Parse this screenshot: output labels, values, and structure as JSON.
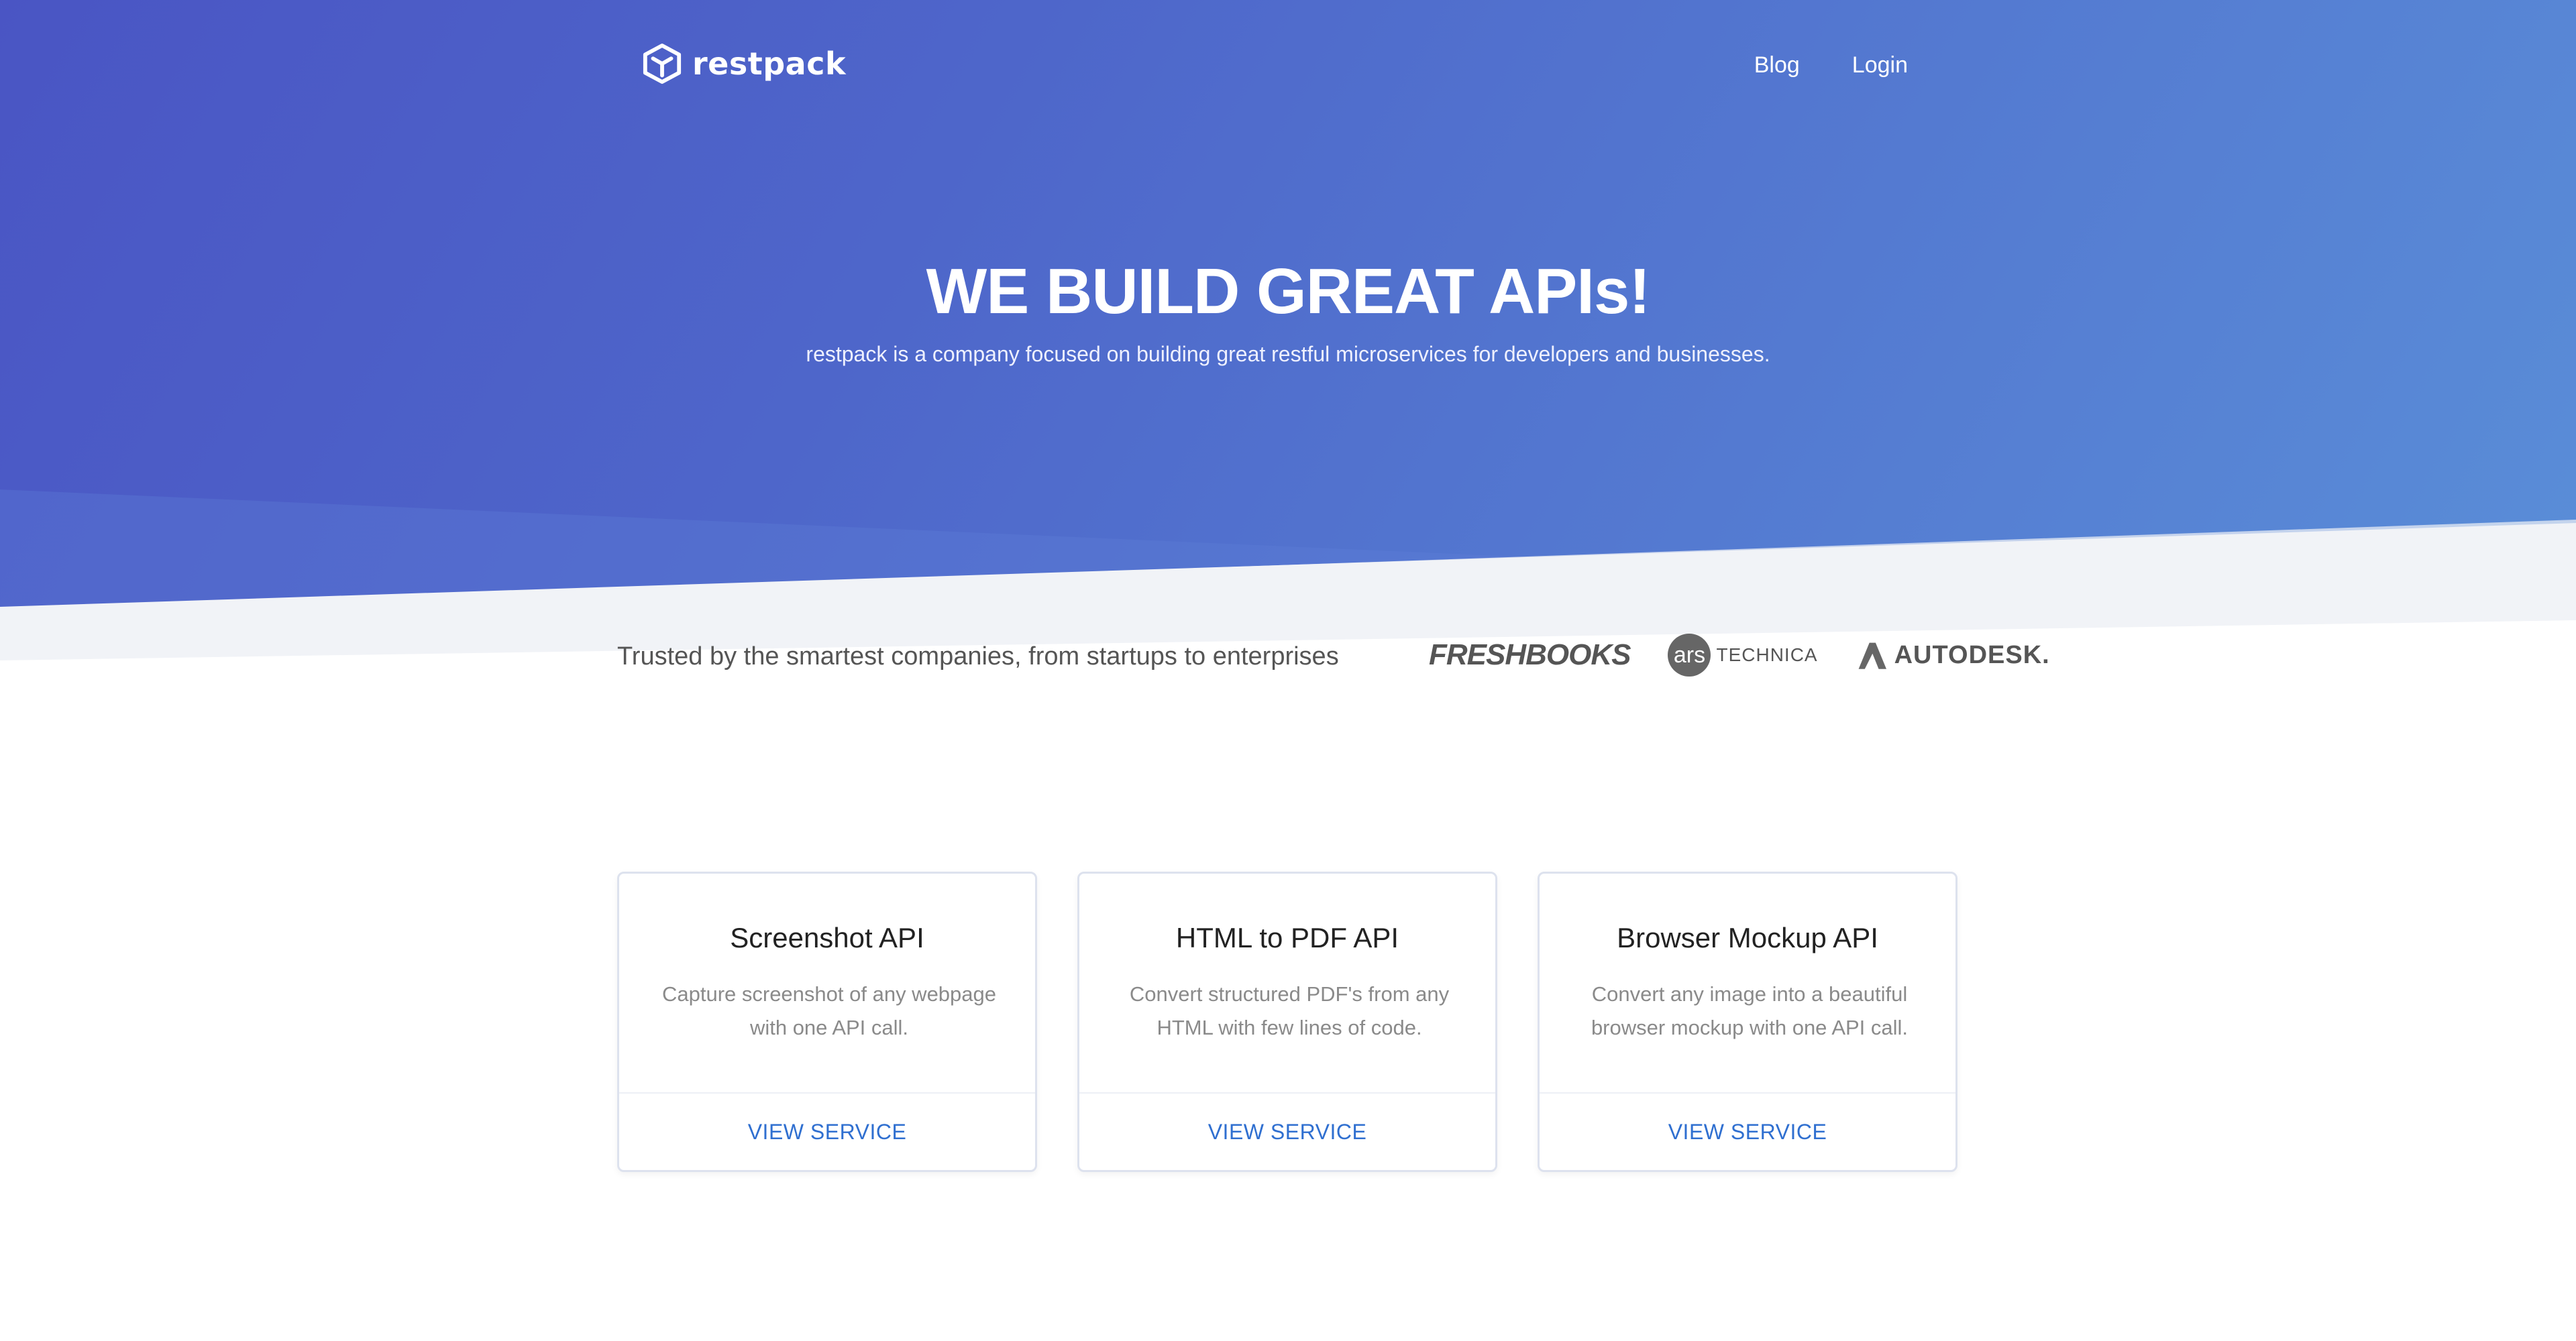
{
  "nav": {
    "brand": "restpack",
    "links": [
      {
        "label": "Blog"
      },
      {
        "label": "Login"
      }
    ]
  },
  "hero": {
    "title": "WE BUILD GREAT APIs!",
    "subtitle": "restpack is a company focused on building great restful microservices for developers and businesses."
  },
  "trusted": {
    "text": "Trusted by the smartest companies, from startups to enterprises",
    "logos": [
      {
        "name": "FreshBooks",
        "text": "FRESHBOOKS"
      },
      {
        "name": "ars technica",
        "badge": "ars",
        "text": "TECHNICA"
      },
      {
        "name": "Autodesk",
        "text": "AUTODESK."
      }
    ]
  },
  "cards": [
    {
      "title": "Screenshot API",
      "description": "Capture screenshot of any webpage with one API call.",
      "cta": "VIEW SERVICE"
    },
    {
      "title": "HTML to PDF API",
      "description": "Convert structured PDF's from any HTML with few lines of code.",
      "cta": "VIEW SERVICE"
    },
    {
      "title": "Browser Mockup API",
      "description": "Convert any image into a beautiful browser mockup with one API call.",
      "cta": "VIEW SERVICE"
    }
  ],
  "colors": {
    "hero_start": "#4a55c4",
    "hero_end": "#5a8ed8",
    "link": "#2f6fd0",
    "text_muted": "#8a8a8a"
  }
}
